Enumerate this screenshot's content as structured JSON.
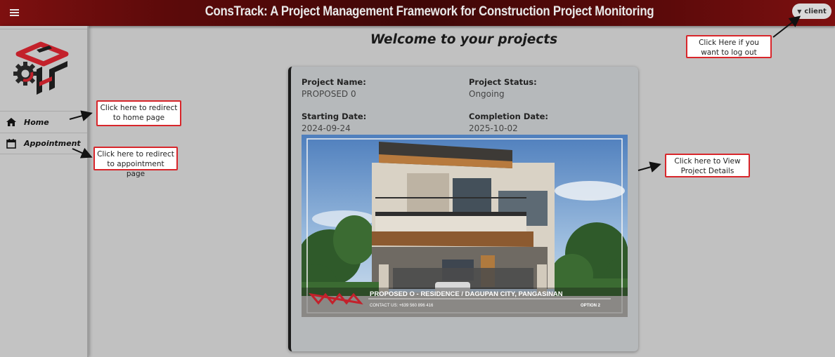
{
  "header": {
    "title": "ConsTrack: A Project Management Framework for Construction Project Monitoring",
    "user_label": "client",
    "brand_color": "#5c0a0a"
  },
  "sidebar": {
    "items": [
      {
        "label": "Home",
        "icon": "home-icon"
      },
      {
        "label": "Appointment",
        "icon": "calendar-icon"
      }
    ]
  },
  "main": {
    "title": "Welcome to your projects",
    "project": {
      "name_label": "Project Name:",
      "name": "PROPOSED 0",
      "status_label": "Project Status:",
      "status": "Ongoing",
      "start_label": "Starting Date:",
      "start": "2024-09-24",
      "end_label": "Completion Date:",
      "end": "2025-10-02",
      "image": {
        "caption": "PROPOSED O - RESIDENCE / DAGUPAN CITY, PANGASINAN",
        "contact": "CONTACT US: +639 560 896 416",
        "option": "OPTION 2"
      }
    }
  },
  "annotations": {
    "home": "Click here to redirect to home page",
    "appointment": "Click here to redirect to appointment  page",
    "details": "Click here to View Project Details",
    "logout": "Click Here if you want to log out",
    "color": "#d8262b"
  }
}
